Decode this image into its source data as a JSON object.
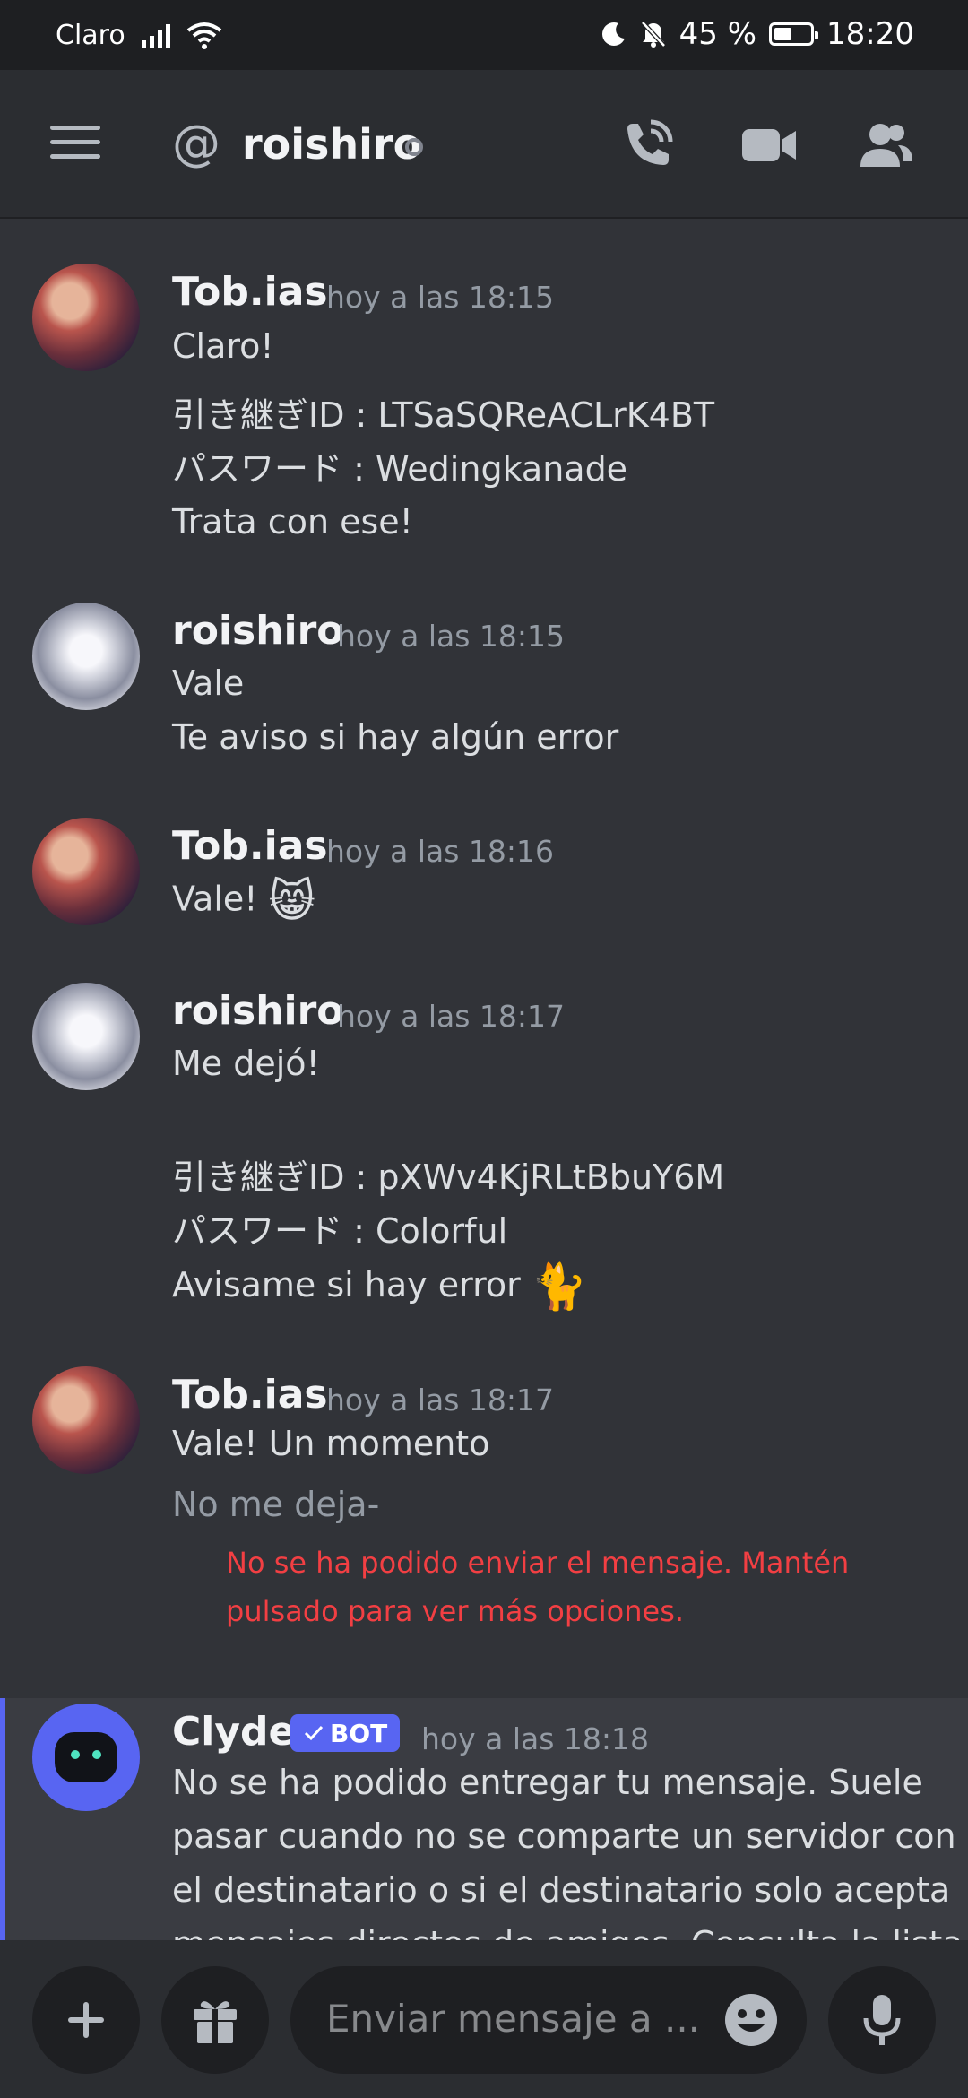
{
  "status_bar": {
    "carrier": "Claro",
    "battery": "45 %",
    "time": "18:20"
  },
  "header": {
    "channel_name": "roishiro"
  },
  "messages": [
    {
      "author": "Tob.ias",
      "time": "hoy a las 18:15",
      "lines": [
        "Claro!",
        "引き継ぎID : LTSaSQReACLrK4BT",
        "パスワード : Wedingkanade",
        "Trata con ese!"
      ]
    },
    {
      "author": "roishiro",
      "time": "hoy a las 18:15",
      "lines": [
        "Vale",
        "Te aviso si hay algún error"
      ]
    },
    {
      "author": "Tob.ias",
      "time": "hoy a las 18:16",
      "lines": [
        "Vale!"
      ],
      "emoji": "😸"
    },
    {
      "author": "roishiro",
      "time": "hoy a las 18:17",
      "lines": [
        "Me dejó!",
        "引き継ぎID : pXWv4KjRLtBbuY6M",
        "パスワード : Colorful",
        "Avisame si hay error"
      ],
      "emoji": "🐈"
    },
    {
      "author": "Tob.ias",
      "time": "hoy a las 18:17",
      "lines": [
        "Vale! Un momento",
        "No me deja-"
      ],
      "error_lines": [
        "No se ha podido enviar el mensaje. Mantén",
        "pulsado para ver más opciones."
      ]
    },
    {
      "author": "Clyde",
      "badge": "BOT",
      "time": "hoy a las 18:18",
      "lines": [
        "No se ha podido entregar tu mensaje. Suele",
        "pasar cuando no se comparte un servidor con",
        "el destinatario o si el destinatario solo acepta",
        "mensajes directos de amigos. Consulta la lista"
      ]
    }
  ],
  "composer": {
    "placeholder": "Enviar mensaje a ..."
  },
  "colors": {
    "background": "#313338",
    "header": "#2b2d31",
    "accent": "#5865f2",
    "error": "#f23f43"
  }
}
